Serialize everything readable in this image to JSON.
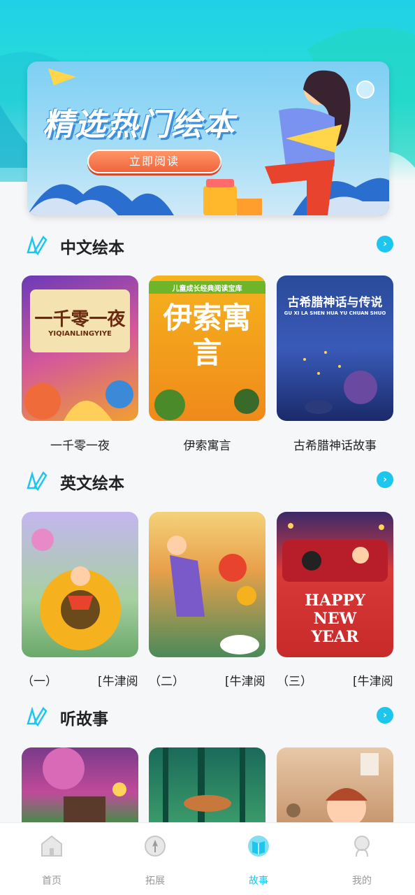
{
  "banner": {
    "title": "精选热门绘本",
    "button_label": "立即阅读"
  },
  "sections": [
    {
      "title": "中文绘本",
      "books": [
        {
          "label": "一千零一夜",
          "cover_title": "一千零一夜",
          "cover_sub": "YIQIANLINGYIYE"
        },
        {
          "label": "伊索寓言",
          "cover_title": "伊索寓言",
          "cover_sub": "儿童成长经典阅读宝库"
        },
        {
          "label": "古希腊神话故事",
          "cover_title": "古希腊神话与传说",
          "cover_sub": "GU XI LA SHEN HUA YU CHUAN SHUO"
        }
      ]
    },
    {
      "title": "英文绘本",
      "books": [
        {
          "label_left": "（一）",
          "label_right": "[牛津阅"
        },
        {
          "label_left": "（二）",
          "label_right": "[牛津阅"
        },
        {
          "label_left": "（三）",
          "label_right": "[牛津阅",
          "cover_text": "HAPPY NEW YEAR"
        }
      ]
    },
    {
      "title": "听故事",
      "books": [
        {},
        {},
        {}
      ]
    }
  ],
  "tabs": [
    {
      "label": "首页",
      "icon": "home-icon",
      "active": false
    },
    {
      "label": "拓展",
      "icon": "compass-icon",
      "active": false
    },
    {
      "label": "故事",
      "icon": "book-icon",
      "active": true
    },
    {
      "label": "我的",
      "icon": "user-icon",
      "active": false
    }
  ],
  "colors": {
    "accent": "#1cc6ee",
    "header": "#2ae0d6",
    "button": "#f0643c"
  }
}
